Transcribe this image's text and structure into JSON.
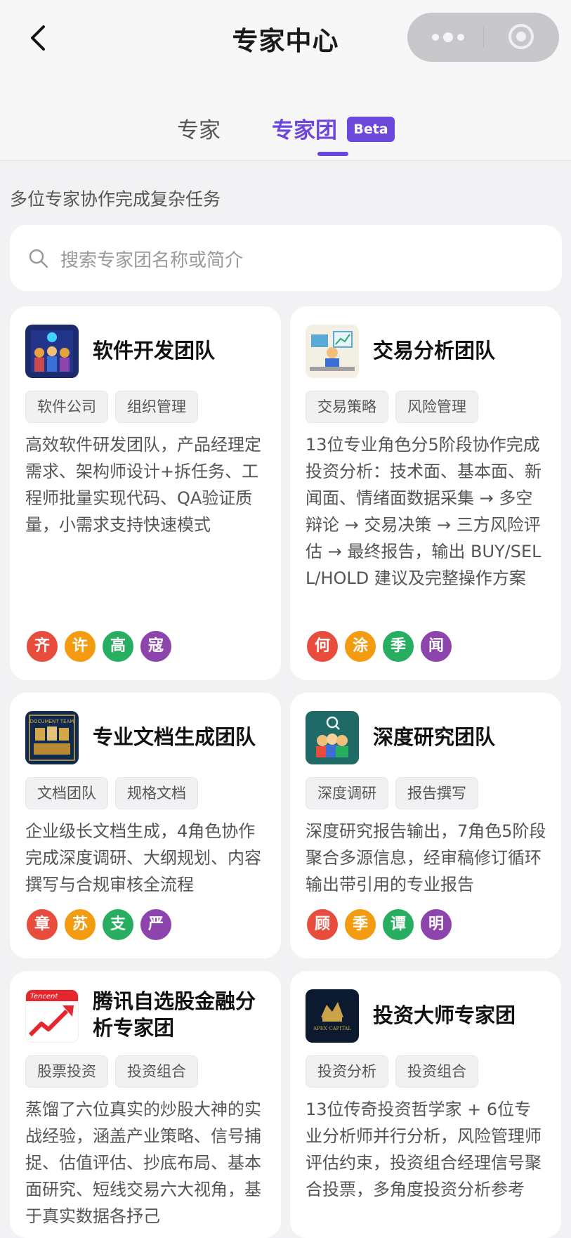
{
  "header": {
    "title": "专家中心"
  },
  "tabs": [
    {
      "label": "专家"
    },
    {
      "label": "专家团",
      "badge": "Beta",
      "active": true
    }
  ],
  "subtitle": "多位专家协作完成复杂任务",
  "search": {
    "placeholder": "搜索专家团名称或简介"
  },
  "colors": {
    "accent": "#6b47dc",
    "avatar_red": "#e74c3c",
    "avatar_orange": "#f39c12",
    "avatar_green": "#27ae60",
    "avatar_purple": "#8e44ad"
  },
  "teams": [
    {
      "name": "软件开发团队",
      "tags": [
        "软件公司",
        "组织管理"
      ],
      "description": "高效软件研发团队，产品经理定需求、架构师设计+拆任务、工程师批量实现代码、QA验证质量，小需求支持快速模式",
      "members": [
        "齐",
        "许",
        "高",
        "寇"
      ],
      "logo": "software-team-illustration"
    },
    {
      "name": "交易分析团队",
      "tags": [
        "交易策略",
        "风险管理"
      ],
      "description": "13位专业角色分5阶段协作完成投资分析：技术面、基本面、新闻面、情绪面数据采集 → 多空辩论 → 交易决策 → 三方风险评估 → 最终报告，输出 BUY/SELL/HOLD 建议及完整操作方案",
      "members": [
        "何",
        "涂",
        "季",
        "闻"
      ],
      "logo": "trading-analyst-illustration"
    },
    {
      "name": "专业文档生成团队",
      "tags": [
        "文档团队",
        "规格文档"
      ],
      "description": "企业级长文档生成，4角色协作完成深度调研、大纲规划、内容撰写与合规审核全流程",
      "members": [
        "章",
        "苏",
        "支",
        "严"
      ],
      "logo": "document-team-illustration",
      "logo_text": "DOCUMENT TEAM"
    },
    {
      "name": "深度研究团队",
      "tags": [
        "深度调研",
        "报告撰写"
      ],
      "description": "深度研究报告输出，7角色5阶段聚合多源信息，经审稿修订循环输出带引用的专业报告",
      "members": [
        "顾",
        "季",
        "谭",
        "明"
      ],
      "logo": "research-team-illustration"
    },
    {
      "name": "腾讯自选股金融分析专家团",
      "tags": [
        "股票投资",
        "投资组合"
      ],
      "description": "蒸馏了六位真实的炒股大神的实战经验，涵盖产业策略、信号捕捉、估值评估、抄底布局、基本面研究、短线交易六大视角，基于真实数据各抒己",
      "logo": "tencent-stock-logo",
      "logo_text": "Tencent"
    },
    {
      "name": "投资大师专家团",
      "tags": [
        "投资分析",
        "投资组合"
      ],
      "description": "13位传奇投资哲学家 + 6位专业分析师并行分析，风险管理师评估约束，投资组合经理信号聚合投票，多角度投资分析参考",
      "logo": "apex-capital-logo",
      "logo_text": "APEX CAPITAL"
    }
  ]
}
